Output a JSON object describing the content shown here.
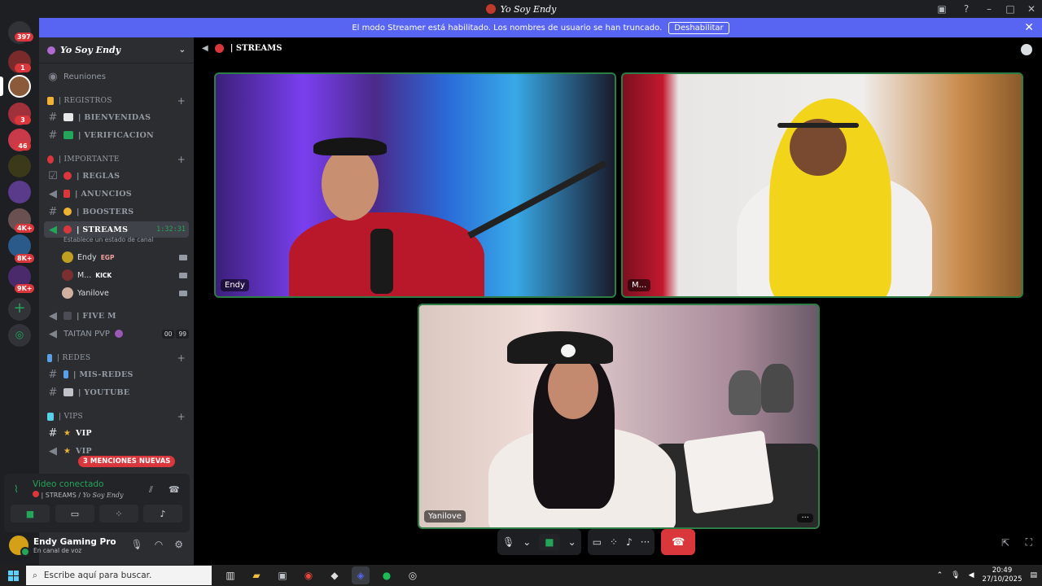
{
  "window": {
    "title": "Yo Soy Endy"
  },
  "banner": {
    "text": "El modo Streamer está habilitado. Los nombres de usuario se han truncado.",
    "button": "Deshabilitar"
  },
  "servers": {
    "badges": [
      "397",
      "1",
      "3",
      "46",
      "4K+",
      "8K+",
      "9K+"
    ]
  },
  "guild": {
    "name": "Yo Soy Endy"
  },
  "channels": {
    "meetings": "Reuniones",
    "cat_registros": "| REGISTROS",
    "bienvenidas": "| BIENVENIDAS",
    "verificacion": "| VERIFICACION",
    "cat_importante": "| IMPORTANTE",
    "reglas": "| REGLAS",
    "anuncios": "| ANUNCIOS",
    "boosters": "| BOOSTERS",
    "streams": "| STREAMS",
    "streams_timer": "1:32:31",
    "streams_status": "Establece un estado de canal",
    "users": [
      {
        "name": "Endy",
        "tag": "EGP",
        "color": "#f23f43"
      },
      {
        "name": "M...",
        "tag": "KICK",
        "color": "#23a55a"
      },
      {
        "name": "Yanilove",
        "tag": "",
        "color": "#dbdee1"
      }
    ],
    "five_m": "| FIVE M",
    "taitan": "TAITAN PVP",
    "taitan_counts": [
      "00",
      "99"
    ],
    "cat_redes": "| REDES",
    "mis_redes": "| MIS-REDES",
    "youtube": "| YOUTUBE",
    "cat_vips": "| VIPS",
    "vip1": "VIP",
    "vip2": "VIP"
  },
  "mentions": "3 MENCIONES NUEVAS",
  "voice": {
    "status": "Video conectado",
    "channel": "| STREAMS / ",
    "server": "Yo Soy Endy"
  },
  "user": {
    "name": "Endy Gaming Pro",
    "status": "En canal de voz"
  },
  "stage": {
    "title": "| STREAMS",
    "tiles": [
      {
        "label": "Endy"
      },
      {
        "label": "M..."
      },
      {
        "label": "Yanilove",
        "more": "···"
      }
    ]
  },
  "taskbar": {
    "search_placeholder": "Escribe aquí para buscar.",
    "time": "20:49",
    "date": "27/10/2025"
  },
  "colors": {
    "accent": "#5865f2",
    "green": "#23a55a",
    "red": "#da373c"
  }
}
